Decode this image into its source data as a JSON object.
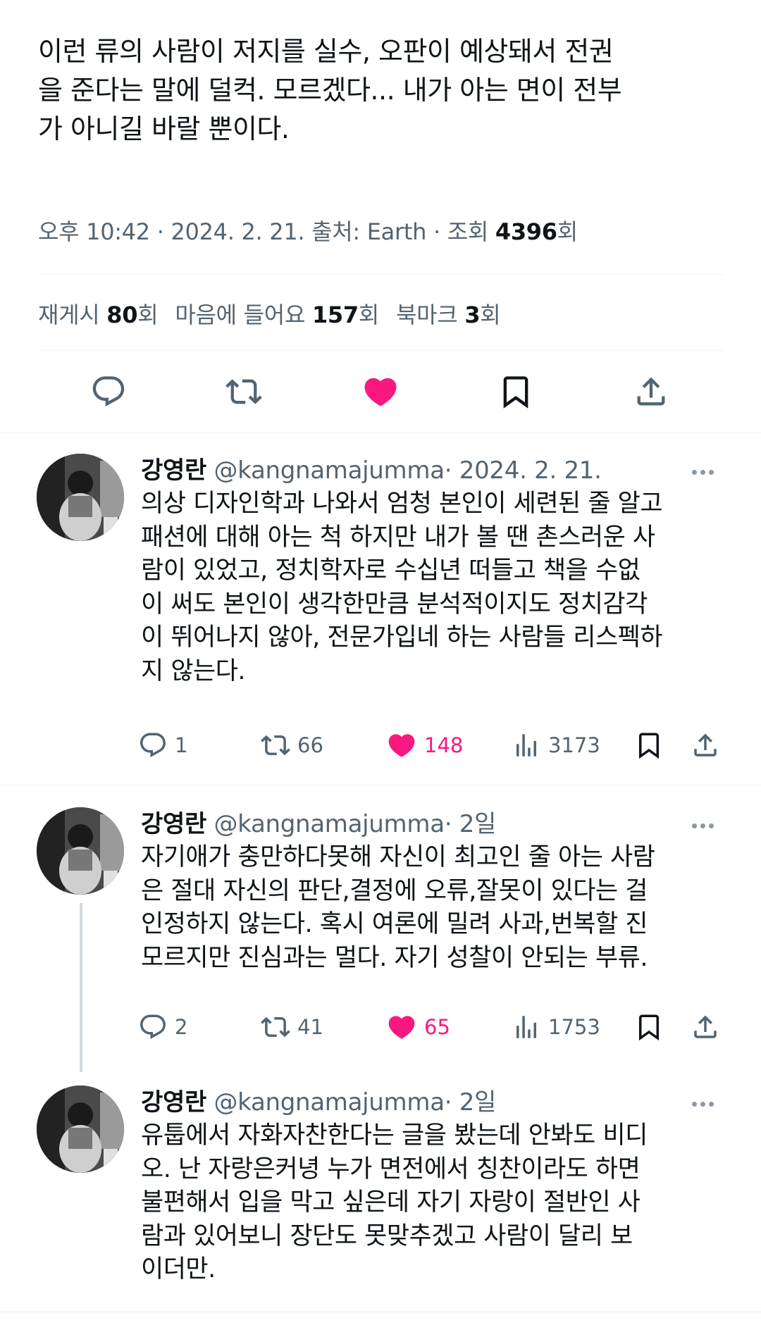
{
  "tweet": {
    "text": "이런 류의 사람이 저지를 실수, 오판이 예상돼서 전권을 준다는 말에 덜컥. 모르겠다... 내가 아는 면이 전부가 아니길 바랄 뿐이다.",
    "line1": "이런 류의 사람이 저지를 실수, 오판이 예상돼서 전권",
    "line2": "을 준다는 말에 덜컥. 모르겠다... 내가 아는 면이 전부",
    "line3": "가 아니길 바랄 뿐이다.",
    "meta_prefix": "오후 10:42 · 2024. 2. 21. 출처: Earth · 조회 ",
    "views": "4396",
    "views_suffix": "회",
    "reposts_label": "재게시 ",
    "reposts": "80",
    "reposts_suffix": "회",
    "likes_label": "마음에 들어요 ",
    "likes": "157",
    "likes_suffix": "회",
    "bookmarks_label": "북마크 ",
    "bookmarks": "3",
    "bookmarks_suffix": "회"
  },
  "icons": {
    "reply": "reply-icon",
    "repost": "repost-icon",
    "like": "heart-icon",
    "bookmark": "bookmark-icon",
    "share": "share-icon",
    "views": "analytics-icon",
    "more": "more-icon"
  },
  "colors": {
    "like_pink": "#f91880",
    "secondary_text": "#536471",
    "thread_line": "#cfd9de"
  },
  "replies": [
    {
      "name": "강영란",
      "handle": "@kangnamajumma",
      "time": "· 2024. 2. 21.",
      "lines": [
        "의상 디자인학과 나와서 엄청 본인이 세련된 줄 알고",
        "패션에 대해 아는 척 하지만  내가 볼 땐 촌스러운 사",
        "람이 있었고,  정치학자로 수십년 떠들고 책을 수없",
        "이 써도 본인이 생각한만큼 분석적이지도 정치감각",
        "이 뛰어나지 않아, 전문가입네 하는 사람들 리스펙하",
        "지 않는다."
      ],
      "replies": "1",
      "reposts": "66",
      "likes": "148",
      "views": "3173"
    },
    {
      "name": "강영란",
      "handle": "@kangnamajumma",
      "time": "· 2일",
      "lines": [
        "자기애가 충만하다못해 자신이 최고인 줄 아는 사람",
        "은 절대 자신의 판단,결정에 오류,잘못이 있다는 걸",
        "인정하지 않는다. 혹시 여론에 밀려 사과,번복할 진",
        "모르지만 진심과는 멀다. 자기 성찰이 안되는 부류."
      ],
      "replies": "2",
      "reposts": "41",
      "likes": "65",
      "views": "1753"
    },
    {
      "name": "강영란",
      "handle": "@kangnamajumma",
      "time": "· 2일",
      "lines": [
        "유툽에서 자화자찬한다는 글을 봤는데 안봐도 비디",
        "오. 난 자랑은커녕 누가 면전에서 칭찬이라도 하면",
        "불편해서 입을 막고 싶은데 자기 자랑이 절반인 사",
        "람과 있어보니 장단도 못맞추겠고 사람이 달리 보",
        "이더만."
      ]
    }
  ]
}
